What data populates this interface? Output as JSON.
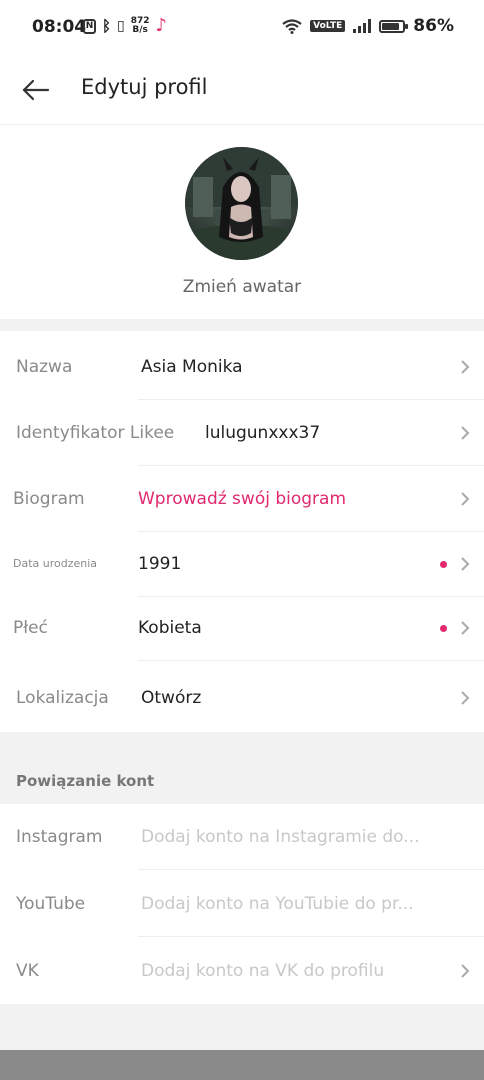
{
  "status_bar": {
    "time": "08:04",
    "net_speed_top": "872",
    "net_speed_bottom": "B/s",
    "volte": "VoLTE",
    "battery_percent": "86%",
    "battery_level": 0.86
  },
  "header": {
    "title": "Edytuj profil"
  },
  "avatar": {
    "change_label": "Zmień awatar"
  },
  "profile_rows": [
    {
      "label": "Nazwa",
      "value": "Asia Monika"
    },
    {
      "label": "Identyfikator Likee",
      "value": "lulugunxxx37"
    },
    {
      "label": "Biogram",
      "value": "Wprowadź swój biogram"
    },
    {
      "label": "Data urodzenia",
      "value": "1991"
    },
    {
      "label": "Płeć",
      "value": "Kobieta"
    },
    {
      "label": "Lokalizacja",
      "value": "Otwórz"
    }
  ],
  "linked_accounts": {
    "title": "Powiązanie kont",
    "items": [
      {
        "label": "Instagram",
        "placeholder": "Dodaj konto na Instagramie do..."
      },
      {
        "label": "YouTube",
        "placeholder": "Dodaj konto na YouTubie do pr..."
      },
      {
        "label": "VK",
        "placeholder": "Dodaj konto na VK do profilu"
      }
    ]
  },
  "colors": {
    "accent": "#e0296e",
    "label_gray": "#8a8a8a",
    "placeholder_gray": "#c8c8c8",
    "section_bg": "#f2f2f2"
  }
}
